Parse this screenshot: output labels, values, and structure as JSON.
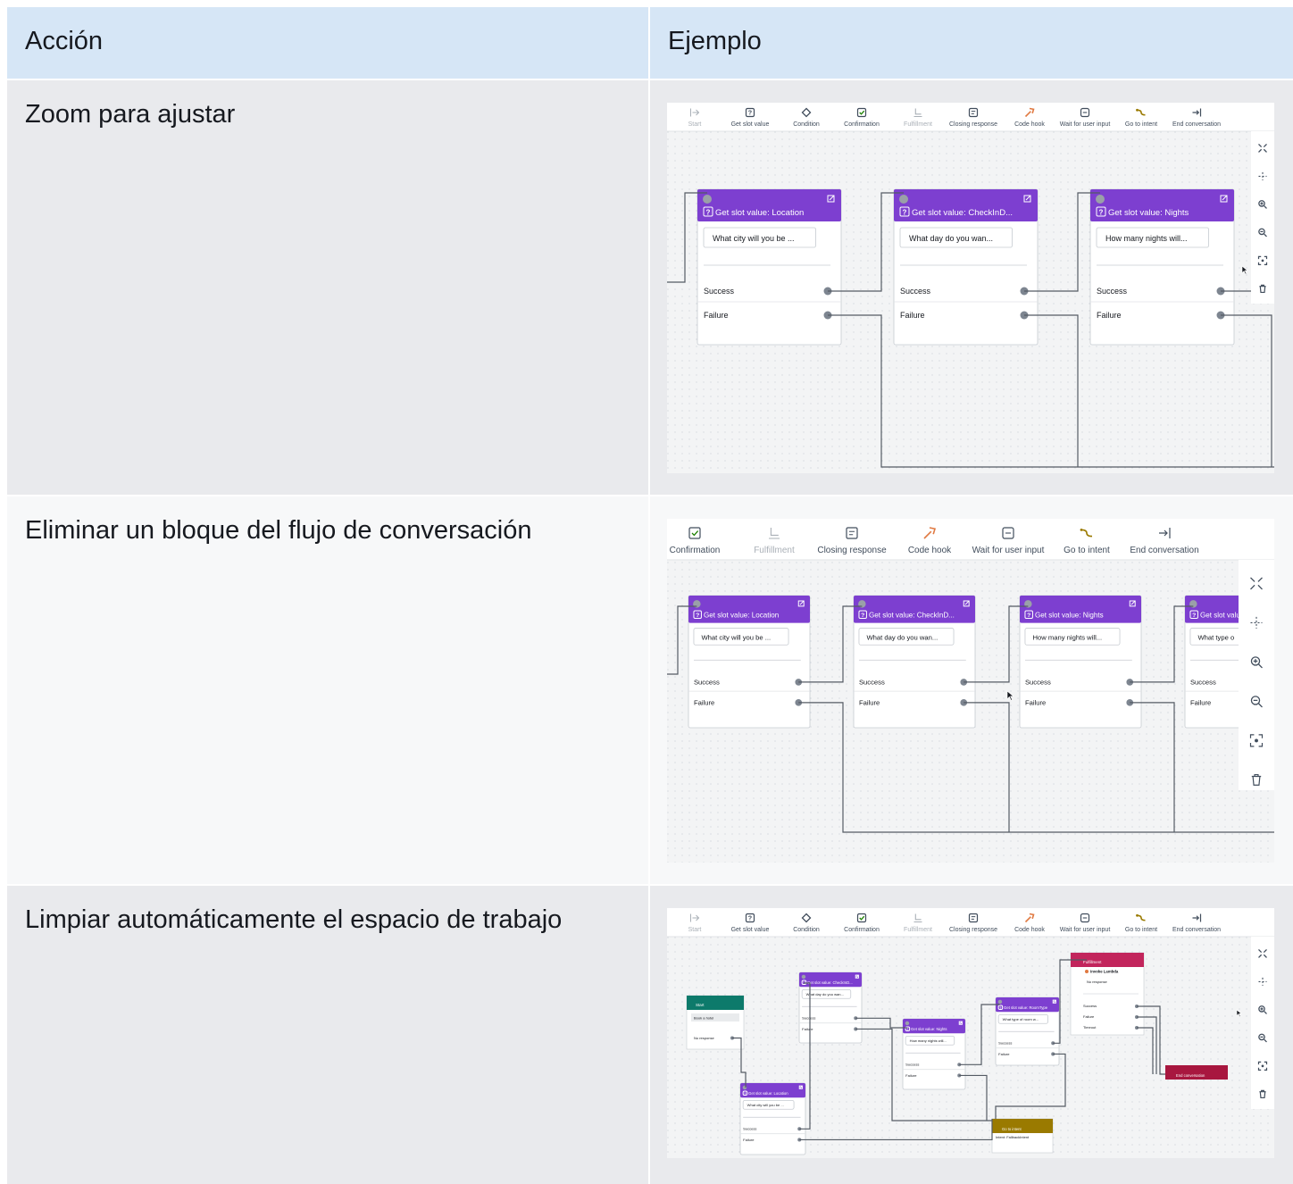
{
  "table": {
    "headers": {
      "action": "Acción",
      "example": "Ejemplo"
    },
    "rows": [
      {
        "action": "Zoom para ajustar"
      },
      {
        "action": "Eliminar un bloque del flujo de conversación"
      },
      {
        "action": "Limpiar automáticamente el espacio de trabajo"
      }
    ]
  },
  "toolbar": {
    "items": [
      {
        "label": "Start",
        "icon": "start-icon",
        "disabled": true
      },
      {
        "label": "Get slot value",
        "icon": "get-slot-value-icon"
      },
      {
        "label": "Condition",
        "icon": "condition-icon"
      },
      {
        "label": "Confirmation",
        "icon": "confirmation-icon"
      },
      {
        "label": "Fulfillment",
        "icon": "fulfillment-icon",
        "disabled": true
      },
      {
        "label": "Closing response",
        "icon": "closing-response-icon"
      },
      {
        "label": "Code hook",
        "icon": "code-hook-icon"
      },
      {
        "label": "Wait for user input",
        "icon": "wait-for-user-input-icon"
      },
      {
        "label": "Go to intent",
        "icon": "go-to-intent-icon"
      },
      {
        "label": "End conversation",
        "icon": "end-conversation-icon"
      }
    ]
  },
  "side_controls": [
    "fit-view-icon",
    "move-icon",
    "zoom-in-icon",
    "zoom-out-icon",
    "auto-arrange-icon",
    "delete-icon"
  ],
  "example1": {
    "blocks": [
      {
        "title": "Get slot value: Location",
        "prompt": "What city will you be ...",
        "success": "Success",
        "failure": "Failure"
      },
      {
        "title": "Get slot value: CheckInD...",
        "prompt": "What day do you wan...",
        "success": "Success",
        "failure": "Failure"
      },
      {
        "title": "Get slot value: Nights",
        "prompt": "How many nights will...",
        "success": "Success",
        "failure": "Failure"
      }
    ]
  },
  "example2": {
    "blocks": [
      {
        "title": "Get slot value: Location",
        "prompt": "What city will you be ...",
        "success": "Success",
        "failure": "Failure"
      },
      {
        "title": "Get slot value: CheckInD...",
        "prompt": "What day do you wan...",
        "success": "Success",
        "failure": "Failure"
      },
      {
        "title": "Get slot value: Nights",
        "prompt": "How many nights will...",
        "success": "Success",
        "failure": "Failure"
      },
      {
        "title": "Get slot valu",
        "prompt": "What type o",
        "success": "Success",
        "failure": "Failure"
      }
    ]
  },
  "example3": {
    "start": {
      "title": "Start",
      "utterance": "Book a hotel",
      "no_response": "No response"
    },
    "location": {
      "title": "Get slot value: Location",
      "prompt": "What city will you be ...",
      "success": "Success",
      "failure": "Failure"
    },
    "checkin": {
      "title": "Get slot value: CheckInD...",
      "prompt": "What day do you wan...",
      "success": "Success",
      "failure": "Failure"
    },
    "nights": {
      "title": "Get slot value: Nights",
      "prompt": "How many nights will...",
      "success": "Success",
      "failure": "Failure"
    },
    "roomtype": {
      "title": "Get slot value: RoomType",
      "prompt": "What type of room w...",
      "success": "Success",
      "failure": "Failure"
    },
    "fulfillment": {
      "title": "Fulfillment",
      "lambda": "Invoke Lambda",
      "no_response": "No response",
      "success": "Success",
      "failure": "Failure",
      "timeout": "Timeout"
    },
    "goto": {
      "title": "Go to intent",
      "intent": "Intent: FallbackIntent"
    },
    "end": {
      "title": "End conversation"
    }
  },
  "colors": {
    "header_bg": "#d6e6f6",
    "row_gray": "#e9eaed",
    "row_light": "#f7f8f9",
    "slot_purple": "#7d3fd0",
    "start_teal": "#0d7a6b",
    "fulfillment_pink": "#c2255c",
    "end_red": "#a8173f",
    "goto_olive": "#9a7a00"
  }
}
